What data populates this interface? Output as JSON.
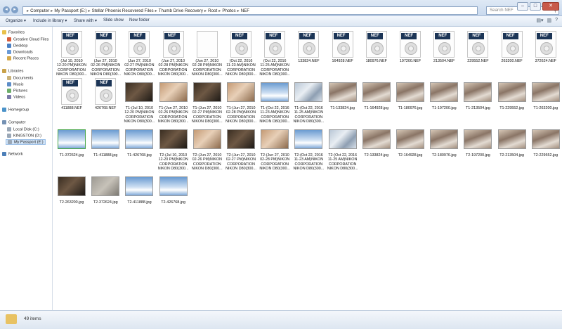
{
  "window": {
    "minimize": "–",
    "maximize": "□",
    "close": "✕"
  },
  "address": {
    "crumbs": [
      "Computer",
      "My Passport (E:)",
      "Stellar Phoenix Recovered Files",
      "Thumb Drive Recovery",
      "Root",
      "Photos",
      "NEF"
    ],
    "separator": "▸"
  },
  "search": {
    "placeholder": "Search NEF"
  },
  "toolbar": {
    "organize": "Organize ▾",
    "include_in_library": "Include in library ▾",
    "share_with": "Share with ▾",
    "slide_show": "Slide show",
    "new_folder": "New folder"
  },
  "sidebar": {
    "favorites": "Favorites",
    "creative_cloud": "Creative Cloud Files",
    "desktop": "Desktop",
    "downloads": "Downloads",
    "recent_places": "Recent Places",
    "libraries": "Libraries",
    "documents": "Documents",
    "music": "Music",
    "pictures": "Pictures",
    "videos": "Videos",
    "homegroup": "Homegroup",
    "computer": "Computer",
    "local_disk": "Local Disk (C:)",
    "kingston": "KINGSTON (D:)",
    "my_passport": "My Passport (E:)",
    "network": "Network"
  },
  "nef_badge": "NEF",
  "files": [
    {
      "kind": "nef",
      "lines": [
        "(Jul 10, 2010",
        "12-20 PM)NIKON",
        "CORPORATION",
        "NIKON D80(300..."
      ]
    },
    {
      "kind": "nef",
      "lines": [
        "(Jun 27, 2010",
        "02-26 PM)NIKON",
        "CORPORATION",
        "NIKON D80(300..."
      ]
    },
    {
      "kind": "nef",
      "lines": [
        "(Jun 27, 2010",
        "02-27 PM)NIKON",
        "CORPORATION",
        "NIKON D80(300..."
      ]
    },
    {
      "kind": "nef",
      "lines": [
        "(Jun 27, 2010",
        "02-28 PM)NIKON",
        "CORPORATION",
        "NIKON D80(300..."
      ]
    },
    {
      "kind": "blank",
      "lines": [
        "(Jun 27, 2010",
        "02-28 PM)NIKON",
        "CORPORATION",
        "NIKON D80(300..."
      ]
    },
    {
      "kind": "nef",
      "lines": [
        "(Oct 22, 2016",
        "11-23 AM)NIKON",
        "CORPORATION",
        "NIKON D80(300..."
      ]
    },
    {
      "kind": "nef",
      "lines": [
        "(Oct 22, 2016",
        "11-25 AM)NIKON",
        "CORPORATION",
        "NIKON D80(300..."
      ]
    },
    {
      "kind": "nef",
      "lines": [
        "133824.NEF"
      ]
    },
    {
      "kind": "nef",
      "lines": [
        "164928.NEF"
      ]
    },
    {
      "kind": "nef",
      "lines": [
        "180976.NEF"
      ]
    },
    {
      "kind": "nef",
      "lines": [
        "197200.NEF"
      ]
    },
    {
      "kind": "nef",
      "lines": [
        "213504.NEF"
      ]
    },
    {
      "kind": "nef",
      "lines": [
        "229552.NEF"
      ]
    },
    {
      "kind": "nef",
      "lines": [
        "263200.NEF"
      ]
    },
    {
      "kind": "nef",
      "lines": [
        "372624.NEF"
      ]
    },
    {
      "kind": "nef",
      "lines": [
        "411888.NEF"
      ]
    },
    {
      "kind": "nef",
      "lines": [
        "426768.NEF"
      ]
    },
    {
      "kind": "photo",
      "style": "p-dark",
      "lines": [
        "T1-(Jul 10, 2010",
        "12-20 PM)NIKON",
        "CORPORATION",
        "NIKON D80(300..."
      ]
    },
    {
      "kind": "photo",
      "style": "p-hand",
      "lines": [
        "T1-(Jun 27, 2010",
        "02-26 PM)NIKON",
        "CORPORATION",
        "NIKON D80(300..."
      ]
    },
    {
      "kind": "photo",
      "style": "p-dark",
      "lines": [
        "T1-(Jun 27, 2010",
        "02-27 PM)NIKON",
        "CORPORATION",
        "NIKON D80(300..."
      ]
    },
    {
      "kind": "photo",
      "style": "p-hand",
      "lines": [
        "T1-(Jun 27, 2010",
        "02-28 PM)NIKON",
        "CORPORATION",
        "NIKON D80(300..."
      ]
    },
    {
      "kind": "photo",
      "style": "p-sky",
      "lines": [
        "T1-(Oct 22, 2016",
        "11-23 AM)NIKON",
        "CORPORATION",
        "NIKON D80(300..."
      ]
    },
    {
      "kind": "photo",
      "style": "p-ice",
      "lines": [
        "T1-(Oct 22, 2016",
        "11-25 AM)NIKON",
        "CORPORATION",
        "NIKON D80(300..."
      ]
    },
    {
      "kind": "photo",
      "style": "p-cat",
      "lines": [
        "T1-133824.jpg"
      ]
    },
    {
      "kind": "photo",
      "style": "p-cat",
      "lines": [
        "T1-164928.jpg"
      ]
    },
    {
      "kind": "photo",
      "style": "p-cat",
      "lines": [
        "T1-180976.jpg"
      ]
    },
    {
      "kind": "photo",
      "style": "p-cat",
      "lines": [
        "T1-197200.jpg"
      ]
    },
    {
      "kind": "photo",
      "style": "p-cat",
      "lines": [
        "T1-213504.jpg"
      ]
    },
    {
      "kind": "photo",
      "style": "p-cat",
      "lines": [
        "T1-229552.jpg"
      ]
    },
    {
      "kind": "photo",
      "style": "p-cat",
      "lines": [
        "T1-263200.jpg"
      ]
    },
    {
      "kind": "photo",
      "style": "p-sky",
      "green": true,
      "lines": [
        "T1-372624.jpg"
      ]
    },
    {
      "kind": "photo",
      "style": "p-sky",
      "lines": [
        "T1-411888.jpg"
      ]
    },
    {
      "kind": "photo",
      "style": "p-sky",
      "lines": [
        "T1-426768.jpg"
      ]
    },
    {
      "kind": "photo",
      "style": "p-dark",
      "lines": [
        "T2-(Jul 10, 2010",
        "12-20 PM)NIKON",
        "CORPORATION",
        "NIKON D80(300..."
      ]
    },
    {
      "kind": "photo",
      "style": "p-hand",
      "lines": [
        "T2-(Jun 27, 2010",
        "02-26 PM)NIKON",
        "CORPORATION",
        "NIKON D80(300..."
      ]
    },
    {
      "kind": "photo",
      "style": "p-dark",
      "lines": [
        "T2-(Jun 27, 2010",
        "02-27 PM)NIKON",
        "CORPORATION",
        "NIKON D80(300..."
      ]
    },
    {
      "kind": "photo",
      "style": "p-hand",
      "lines": [
        "T2-(Jun 27, 2010",
        "02-28 PM)NIKON",
        "CORPORATION",
        "NIKON D80(300..."
      ]
    },
    {
      "kind": "photo",
      "style": "p-sky",
      "lines": [
        "T2-(Oct 22, 2016",
        "11-23 AM)NIKON",
        "CORPORATION",
        "NIKON D80(300..."
      ]
    },
    {
      "kind": "photo",
      "style": "p-ice",
      "lines": [
        "T2-(Oct 22, 2016",
        "11-25 AM)NIKON",
        "CORPORATION",
        "NIKON D80(300..."
      ]
    },
    {
      "kind": "photo",
      "style": "p-cat",
      "lines": [
        "T2-133824.jpg"
      ]
    },
    {
      "kind": "photo",
      "style": "p-cat",
      "lines": [
        "T2-164928.jpg"
      ]
    },
    {
      "kind": "photo",
      "style": "p-cat",
      "lines": [
        "T2-180976.jpg"
      ]
    },
    {
      "kind": "photo",
      "style": "p-cat",
      "lines": [
        "T2-197200.jpg"
      ]
    },
    {
      "kind": "photo",
      "style": "p-cat",
      "lines": [
        "T2-213504.jpg"
      ]
    },
    {
      "kind": "photo",
      "style": "p-cat",
      "lines": [
        "T2-229552.jpg"
      ]
    },
    {
      "kind": "photo",
      "style": "p-dark",
      "lines": [
        "T2-263200.jpg"
      ]
    },
    {
      "kind": "photo",
      "style": "p-gray",
      "lines": [
        "T2-372624.jpg"
      ]
    },
    {
      "kind": "photo",
      "style": "p-sky",
      "lines": [
        "T2-411888.jpg"
      ]
    },
    {
      "kind": "photo",
      "style": "p-sky",
      "lines": [
        "T2-426768.jpg"
      ]
    }
  ],
  "status": {
    "count": "49 items"
  }
}
